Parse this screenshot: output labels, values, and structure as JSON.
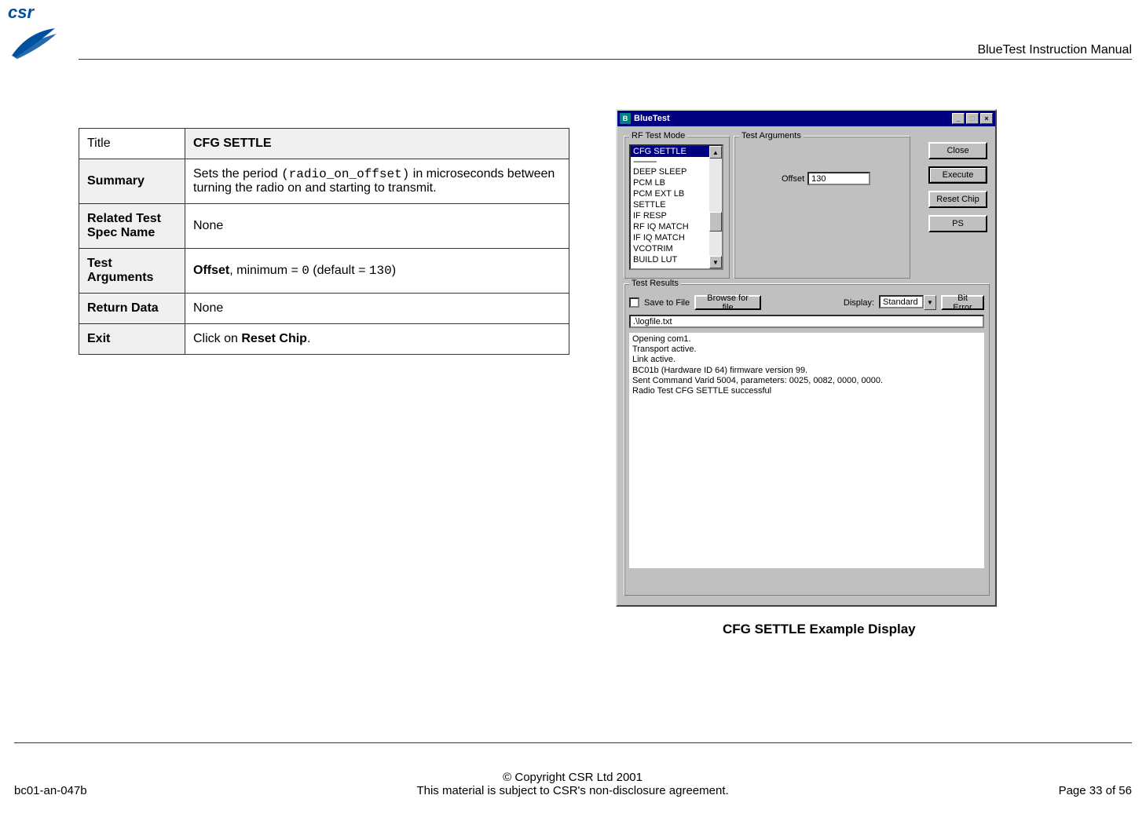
{
  "header": {
    "logo_text": "csr",
    "title": "BlueTest Instruction Manual"
  },
  "table": {
    "rows": [
      {
        "label": "Title",
        "value_bold": "CFG SETTLE"
      },
      {
        "label": "Summary",
        "value_pre": "Sets the period ",
        "value_mono": "(radio_on_offset)",
        "value_post": " in microseconds between turning the radio on and starting to transmit."
      },
      {
        "label": "Related Test Spec Name",
        "value": "None"
      },
      {
        "label": "Test Arguments",
        "arg_bold": "Offset",
        "arg_text": ", minimum = ",
        "arg_mono1": " 0",
        "arg_mid": " (default = ",
        "arg_mono2": "130",
        "arg_end": ")"
      },
      {
        "label": "Return Data",
        "value": "None"
      },
      {
        "label": "Exit",
        "value_pre": "Click on ",
        "value_bold_inline": "Reset Chip",
        "value_post": "."
      }
    ]
  },
  "screenshot": {
    "window_title": "BlueTest",
    "group_rf": "RF Test Mode",
    "group_args": "Test Arguments",
    "group_results": "Test Results",
    "rf_items": [
      "CFG SETTLE",
      "-----------",
      "DEEP SLEEP",
      "PCM LB",
      "PCM EXT LB",
      "SETTLE",
      "IF RESP",
      "RF IQ MATCH",
      "IF IQ MATCH",
      "VCOTRIM",
      "BUILD LUT"
    ],
    "offset_label": "Offset",
    "offset_value": "130",
    "buttons": {
      "close": "Close",
      "execute": "Execute",
      "reset": "Reset Chip",
      "ps": "PS",
      "browse": "Browse for file",
      "biterror": "Bit Error"
    },
    "save_to_file": "Save to File",
    "display_label": "Display:",
    "display_value": "Standard",
    "file_path": ".\\logfile.txt",
    "log_text": "Opening com1.\nTransport active.\nLink active.\nBC01b (Hardware ID 64) firmware version 99.\nSent Command Varid 5004, parameters: 0025, 0082, 0000, 0000.\nRadio Test CFG SETTLE successful"
  },
  "figure_caption": "CFG SETTLE Example Display",
  "footer": {
    "doc_id": "bc01-an-047b",
    "copyright": "© Copyright CSR Ltd 2001",
    "nda": "This material is subject to CSR's non-disclosure agreement.",
    "page": "Page 33 of 56"
  }
}
